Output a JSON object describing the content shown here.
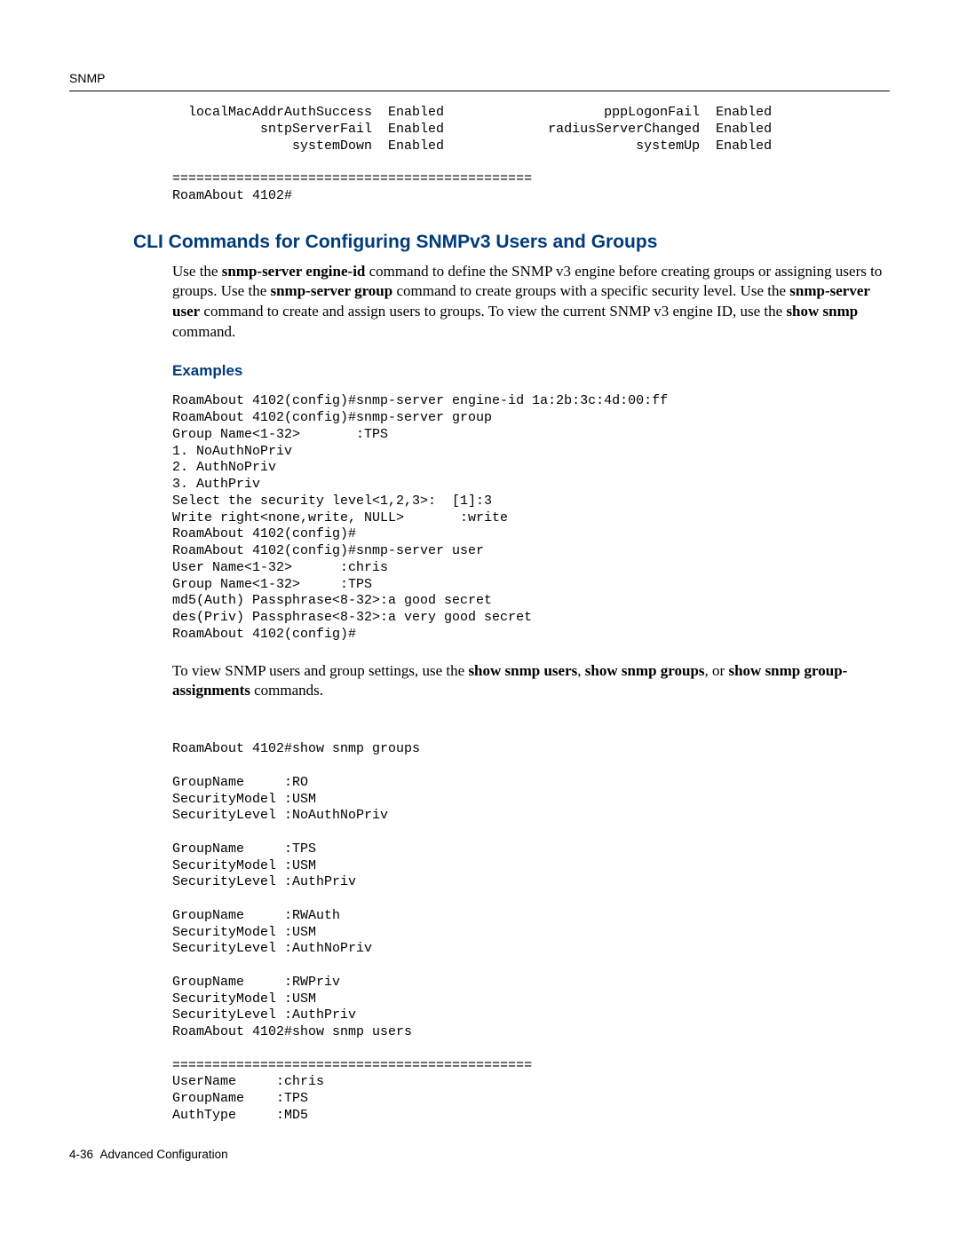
{
  "header": {
    "running_head": "SNMP"
  },
  "top_code": "  localMacAddrAuthSuccess  Enabled                    pppLogonFail  Enabled\n           sntpServerFail  Enabled             radiusServerChanged  Enabled\n               systemDown  Enabled                        systemUp  Enabled\n\n=============================================\nRoamAbout 4102#",
  "section": {
    "title": "CLI Commands for Configuring SNMPv3 Users and Groups",
    "intro_html": "Use the <span class=\"cmd\">snmp-server engine-id</span> command to define the SNMP v3 engine before creating groups or assigning users to groups. Use the <span class=\"cmd\">snmp-server group</span> command to create groups with a specific security level. Use the <span class=\"cmd\">snmp-server user</span> command to create and assign users to groups. To view the current SNMP v3 engine ID, use the <span class=\"cmd\">show snmp</span> command.",
    "examples_label": "Examples"
  },
  "examples_code": "RoamAbout 4102(config)#snmp-server engine-id 1a:2b:3c:4d:00:ff\nRoamAbout 4102(config)#snmp-server group\nGroup Name<1-32>       :TPS\n1. NoAuthNoPriv\n2. AuthNoPriv\n3. AuthPriv\nSelect the security level<1,2,3>:  [1]:3\nWrite right<none,write, NULL>       :write\nRoamAbout 4102(config)#\nRoamAbout 4102(config)#snmp-server user\nUser Name<1-32>      :chris\nGroup Name<1-32>     :TPS\nmd5(Auth) Passphrase<8-32>:a good secret\ndes(Priv) Passphrase<8-32>:a very good secret\nRoamAbout 4102(config)#",
  "middle_paragraph_html": "To view SNMP users and group settings, use the <span class=\"cmd\">show snmp users</span>, <span class=\"cmd\">show snmp groups</span>, or <span class=\"cmd\">show snmp group-assignments</span> commands.",
  "show_output": "RoamAbout 4102#show snmp groups\n\nGroupName     :RO\nSecurityModel :USM\nSecurityLevel :NoAuthNoPriv\n\nGroupName     :TPS\nSecurityModel :USM\nSecurityLevel :AuthPriv\n\nGroupName     :RWAuth\nSecurityModel :USM\nSecurityLevel :AuthNoPriv\n\nGroupName     :RWPriv\nSecurityModel :USM\nSecurityLevel :AuthPriv\nRoamAbout 4102#show snmp users\n\n=============================================\nUserName     :chris\nGroupName    :TPS\nAuthType     :MD5",
  "footer": {
    "page_label": "4-36",
    "section_label": "Advanced Configuration"
  }
}
